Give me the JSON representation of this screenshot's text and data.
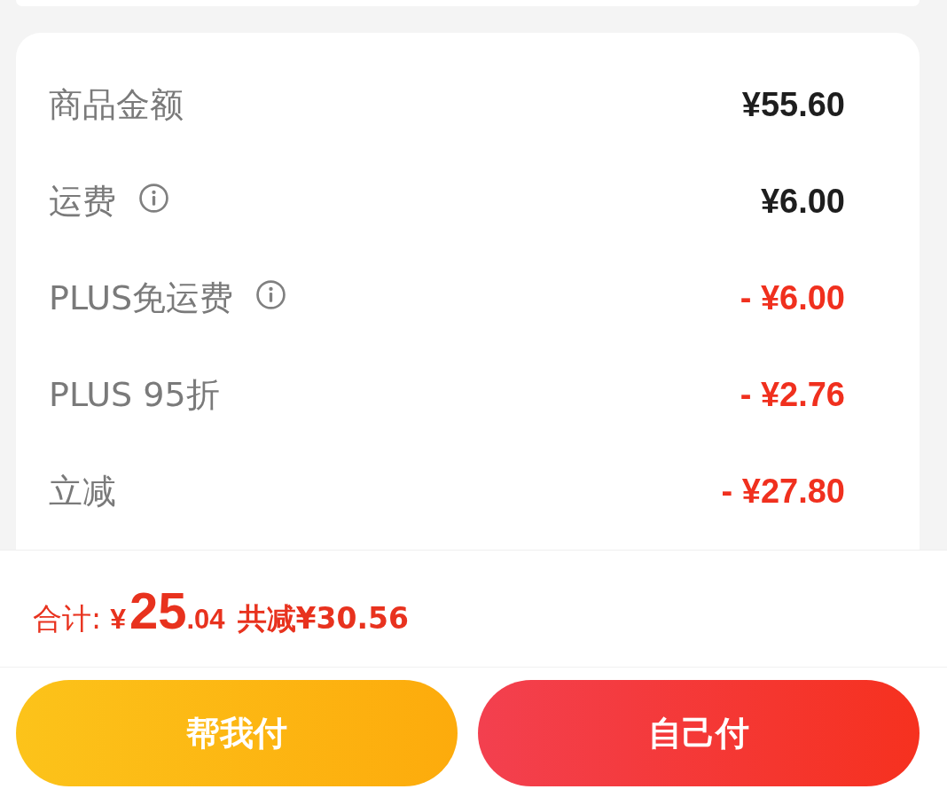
{
  "summary": {
    "rows": [
      {
        "label": "商品金额",
        "value": "¥55.60",
        "info": false,
        "kind": "charge"
      },
      {
        "label": "运费",
        "value": "¥6.00",
        "info": true,
        "kind": "charge"
      },
      {
        "label": "PLUS免运费",
        "value": "- ¥6.00",
        "info": true,
        "kind": "discount"
      },
      {
        "label": "PLUS 95折",
        "value": "- ¥2.76",
        "info": false,
        "kind": "discount"
      },
      {
        "label": "立减",
        "value": "- ¥27.80",
        "info": false,
        "kind": "discount"
      }
    ]
  },
  "total": {
    "label": "合计:",
    "currency": "¥",
    "integer": "25",
    "decimal": ".04",
    "savings": "共减¥30.56"
  },
  "buttons": [
    {
      "label": "帮我付",
      "kind": "friend"
    },
    {
      "label": "自己付",
      "kind": "self"
    }
  ]
}
